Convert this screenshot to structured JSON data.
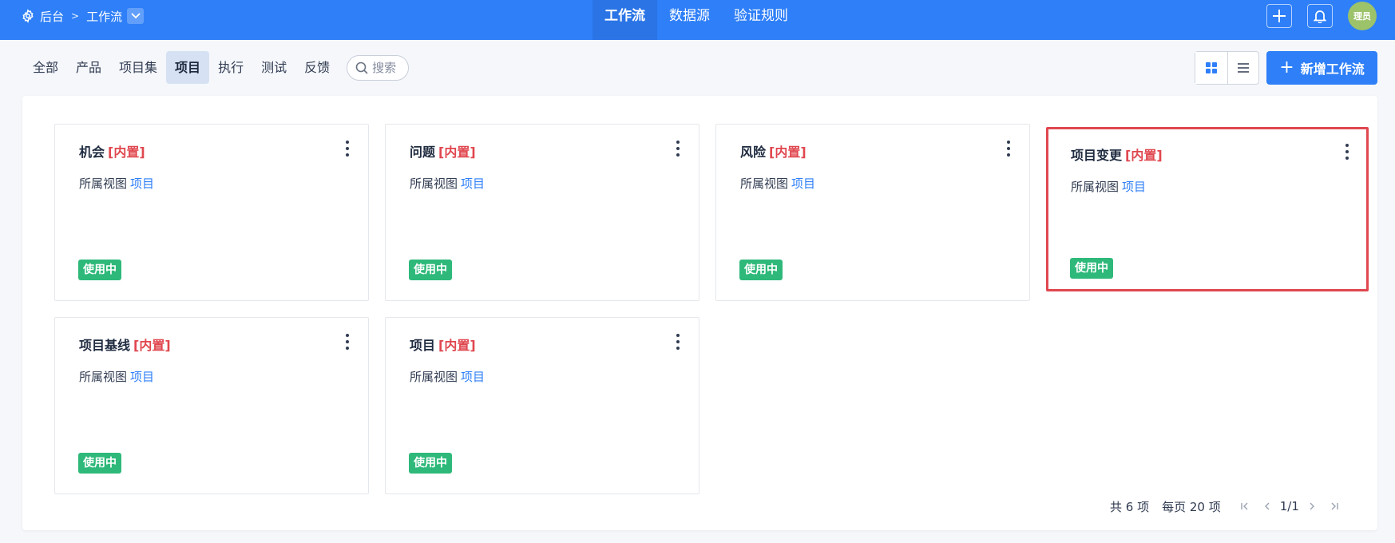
{
  "breadcrumb": {
    "root": "后台",
    "current": "工作流"
  },
  "topnav": {
    "items": [
      "工作流",
      "数据源",
      "验证规则"
    ]
  },
  "user": {
    "avatar_text": "理员"
  },
  "filters": {
    "tabs": [
      "全部",
      "产品",
      "项目集",
      "项目",
      "执行",
      "测试",
      "反馈"
    ],
    "search_placeholder": "搜索"
  },
  "toolbar": {
    "add_label": "新增工作流"
  },
  "cards": [
    {
      "name": "机会",
      "tag": "[内置]",
      "view_label": "所属视图",
      "view_value": "项目",
      "status": "使用中"
    },
    {
      "name": "问题",
      "tag": "[内置]",
      "view_label": "所属视图",
      "view_value": "项目",
      "status": "使用中"
    },
    {
      "name": "风险",
      "tag": "[内置]",
      "view_label": "所属视图",
      "view_value": "项目",
      "status": "使用中"
    },
    {
      "name": "项目变更",
      "tag": "[内置]",
      "view_label": "所属视图",
      "view_value": "项目",
      "status": "使用中"
    },
    {
      "name": "项目基线",
      "tag": "[内置]",
      "view_label": "所属视图",
      "view_value": "项目",
      "status": "使用中"
    },
    {
      "name": "项目",
      "tag": "[内置]",
      "view_label": "所属视图",
      "view_value": "项目",
      "status": "使用中"
    }
  ],
  "pager": {
    "total": "共 6 项",
    "per_page": "每页 20 项",
    "page": "1/1"
  },
  "colors": {
    "primary": "#2e7ff8",
    "builtin_tag": "#e0474f",
    "status_badge": "#2eb97a",
    "highlight_border": "#e0474f"
  }
}
